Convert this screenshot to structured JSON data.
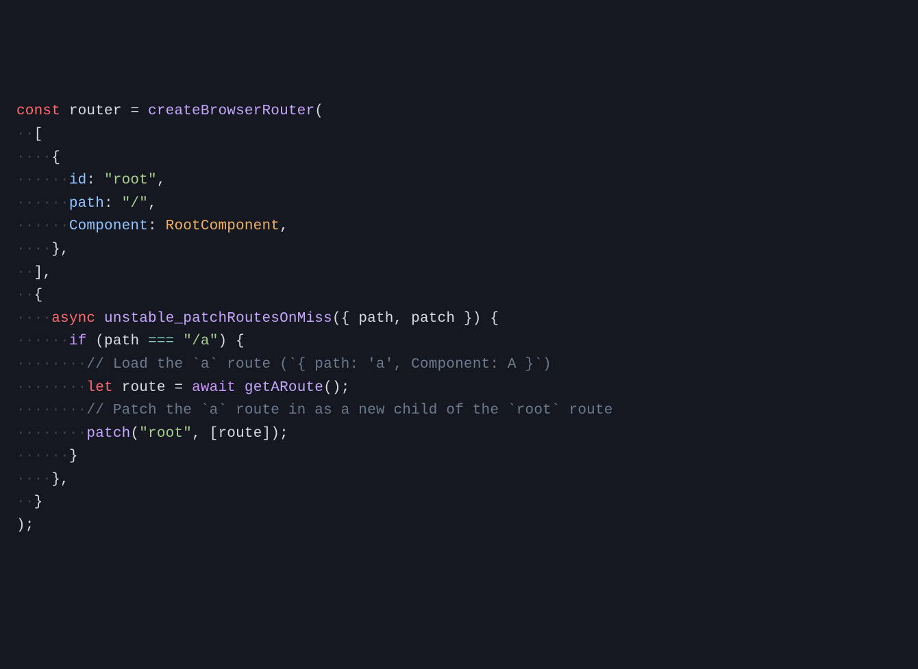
{
  "code": {
    "line1": {
      "kw_const": "const",
      "ident_router": "router",
      "eq": " = ",
      "fn": "createBrowserRouter",
      "open": "("
    },
    "line2": {
      "ws": "··",
      "bracket": "["
    },
    "line3": {
      "ws": "····",
      "brace": "{"
    },
    "line4": {
      "ws": "······",
      "prop": "id",
      "colon": ": ",
      "str": "\"root\"",
      "comma": ","
    },
    "line5": {
      "ws": "······",
      "prop": "path",
      "colon": ": ",
      "str": "\"/\"",
      "comma": ","
    },
    "line6": {
      "ws": "······",
      "prop": "Component",
      "colon": ": ",
      "class": "RootComponent",
      "comma": ","
    },
    "line7": {
      "ws": "····",
      "brace": "}",
      "comma": ","
    },
    "line8": {
      "ws": "··",
      "bracket": "]",
      "comma": ","
    },
    "line9": {
      "ws": "··",
      "brace": "{"
    },
    "line10": {
      "ws": "····",
      "async": "async",
      "sp": " ",
      "method": "unstable_patchRoutesOnMiss",
      "open": "(",
      "destruct_open": "{ ",
      "param1": "path",
      "sep": ", ",
      "param2": "patch",
      "destruct_close": " }",
      "close": ")",
      "sp2": " ",
      "brace": "{"
    },
    "line11": {
      "ws": "······",
      "if": "if",
      "sp": " ",
      "open": "(",
      "ident": "path",
      "sp2": " ",
      "op": "===",
      "sp3": " ",
      "str": "\"/a\"",
      "close": ")",
      "sp4": " ",
      "brace": "{"
    },
    "line12": {
      "ws": "········",
      "comment": "// Load the `a` route (`{ path: 'a', Component: A }`)"
    },
    "line13": {
      "ws": "········",
      "let": "let",
      "sp": " ",
      "ident": "route",
      "sp2": " = ",
      "await": "await",
      "sp3": " ",
      "fn": "getARoute",
      "call": "();"
    },
    "line14": {
      "ws": "········",
      "comment": "// Patch the `a` route in as a new child of the `root` route"
    },
    "line15": {
      "ws": "········",
      "fn": "patch",
      "open": "(",
      "str": "\"root\"",
      "sep": ", ",
      "arr_open": "[",
      "ident": "route",
      "arr_close": "]",
      "close": ");"
    },
    "line16": {
      "ws": "······",
      "brace": "}"
    },
    "line17": {
      "ws": "····",
      "brace": "}",
      "comma": ","
    },
    "line18": {
      "ws": "··",
      "brace": "}"
    },
    "line19": {
      "close": ");"
    }
  }
}
